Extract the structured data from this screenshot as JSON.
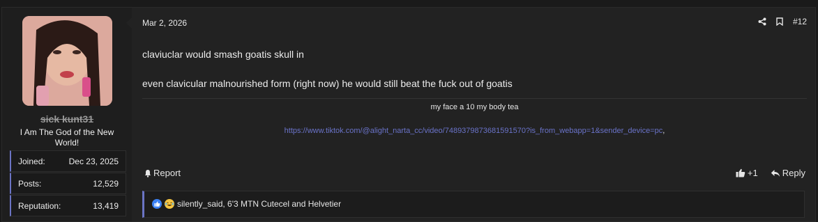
{
  "user": {
    "name": "sick kunt31",
    "title": "I Am The God of the New World!",
    "stats": [
      {
        "label": "Joined:",
        "value": "Dec 23, 2025"
      },
      {
        "label": "Posts:",
        "value": "12,529"
      },
      {
        "label": "Reputation:",
        "value": "13,419"
      }
    ]
  },
  "post": {
    "date": "Mar 2, 2026",
    "number": "#12",
    "paragraphs": [
      "claviuclar would smash goatis skull in",
      "even clavicular malnourished form (right now) he would still beat the fuck out of goatis"
    ],
    "signature": {
      "line": "my face a 10 my body tea",
      "link": "https://www.tiktok.com/@alight_narta_cc/video/7489379873681591570?is_from_webapp=1&sender_device=pc",
      "link_suffix": ","
    }
  },
  "footer": {
    "report_label": "Report",
    "like_count": "+1",
    "reply_label": "Reply"
  },
  "reactions": {
    "text": "silently_said, 6'3 MTN Cutecel and Helvetier"
  },
  "colors": {
    "accent": "#6b74c4",
    "link": "#6a73c9",
    "background": "#222222"
  }
}
